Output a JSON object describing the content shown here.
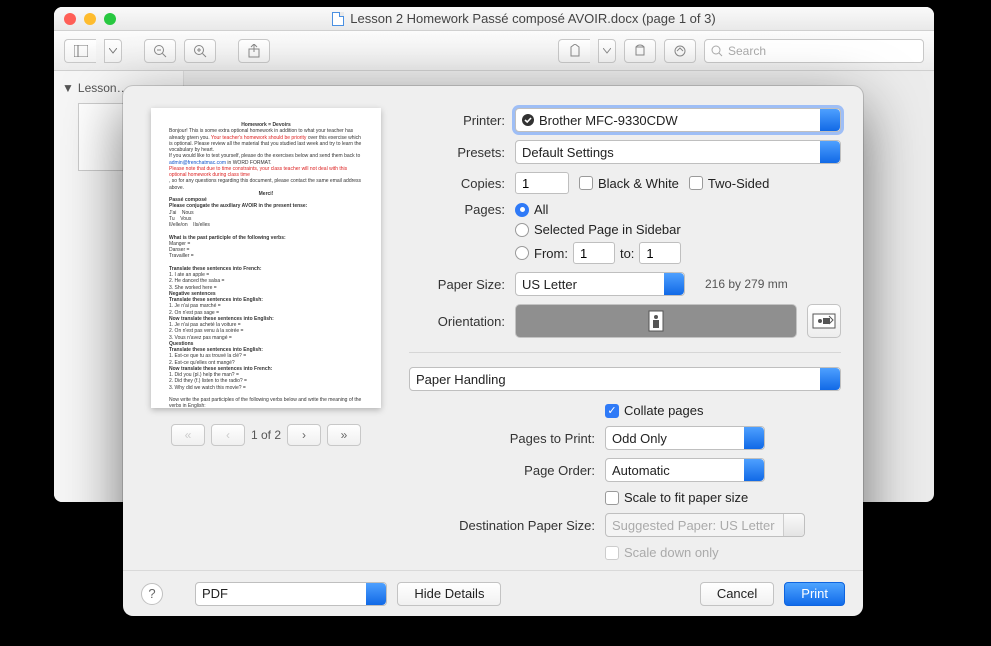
{
  "window": {
    "title": "Lesson 2 Homework Passé composé AVOIR.docx (page 1 of 3)",
    "search_placeholder": "Search"
  },
  "sidebar": {
    "doc_short": "Lesson…"
  },
  "preview": {
    "page_indicator": "1 of 2"
  },
  "print": {
    "labels": {
      "printer": "Printer:",
      "presets": "Presets:",
      "copies": "Copies:",
      "pages": "Pages:",
      "paper_size": "Paper Size:",
      "orientation": "Orientation:",
      "pages_to_print": "Pages to Print:",
      "page_order": "Page Order:",
      "dest_size": "Destination Paper Size:"
    },
    "printer": "Brother MFC-9330CDW",
    "presets": "Default Settings",
    "copies": "1",
    "bw": "Black & White",
    "two_sided": "Two-Sided",
    "pages_all": "All",
    "pages_sidebar": "Selected Page in Sidebar",
    "pages_from_label": "From:",
    "pages_from": "1",
    "pages_to_label": "to:",
    "pages_to": "1",
    "paper_size": "US Letter",
    "paper_size_hint": "216 by 279 mm",
    "section": "Paper Handling",
    "collate": "Collate pages",
    "pages_to_print": "Odd Only",
    "page_order": "Automatic",
    "scale_fit": "Scale to fit paper size",
    "dest_size": "Suggested Paper: US Letter",
    "scale_down": "Scale down only"
  },
  "footer": {
    "pdf": "PDF",
    "hide_details": "Hide Details",
    "cancel": "Cancel",
    "print": "Print"
  }
}
